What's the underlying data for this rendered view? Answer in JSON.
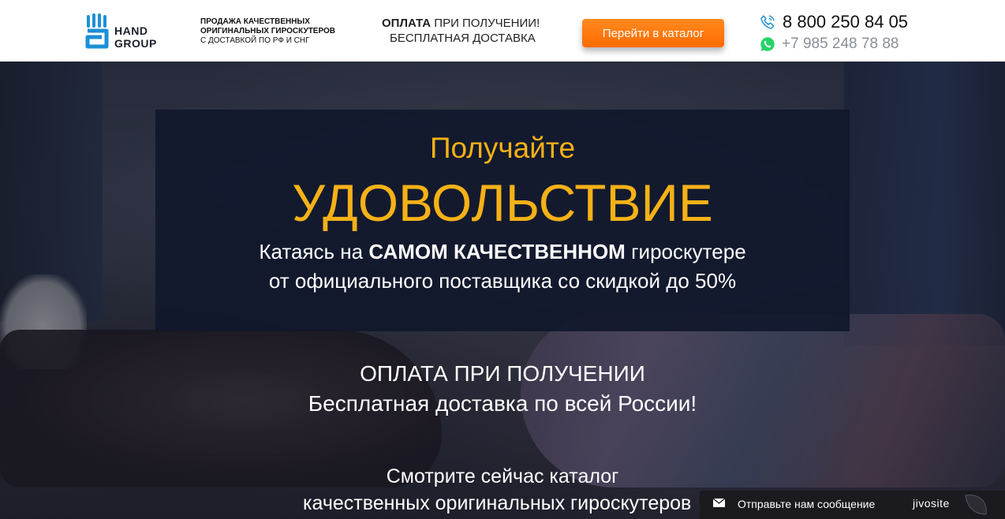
{
  "header": {
    "logo_line1": "HAND",
    "logo_line2": "GROUP",
    "tagline_line1": "ПРОДАЖА КАЧЕСТВЕННЫХ",
    "tagline_line2": "ОРИГИНАЛЬНЫХ ГИРОСКУТЕРОВ",
    "tagline_line3": "С ДОСТАВКОЙ ПО РФ И СНГ",
    "pay_bold": "ОПЛАТА",
    "pay_rest": "ПРИ ПОЛУЧЕНИИ!",
    "delivery": "БЕСПЛАТНАЯ ДОСТАВКА",
    "catalog_button": "Перейти в каталог",
    "phone_main": "8 800 250 84 05",
    "phone_whatsapp": "+7 985 248 78 88"
  },
  "hero": {
    "heading_small": "Получайте",
    "heading_big": "УДОВОЛЬСТВИЕ",
    "sub_pre": "Катаясь на",
    "sub_bold": "САМОМ КАЧЕСТВЕННОМ",
    "sub_post": "гироскутере",
    "sub_line2": "от официального поставщика со скидкой до 50%",
    "payment_line": "ОПЛАТА ПРИ ПОЛУЧЕНИИ",
    "delivery_line": "Бесплатная доставка по всей России!",
    "catalog_line1": "Смотрите сейчас каталог",
    "catalog_line2": "качественных оригинальных гироскутеров"
  },
  "chat_widget": {
    "message_label": "Отправьте нам сообщение",
    "brand": "jivosite"
  },
  "colors": {
    "accent_orange": "#ff7a0f",
    "heading_gold": "#f5b117",
    "logo_blue": "#1d8fd6",
    "whatsapp_green": "#25d366"
  },
  "icons": {
    "logo": "hand-logo-icon",
    "phone": "phone-icon",
    "whatsapp": "whatsapp-icon",
    "envelope": "envelope-icon",
    "leaf": "jivo-leaf-icon"
  }
}
